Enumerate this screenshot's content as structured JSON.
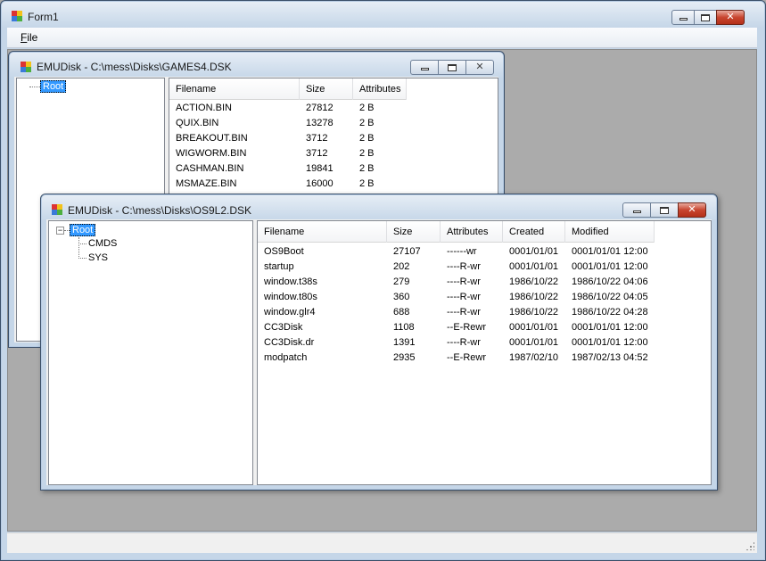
{
  "form": {
    "title": "Form1",
    "menu": [
      "File"
    ]
  },
  "window1": {
    "title": "EMUDisk - C:\\mess\\Disks\\GAMES4.DSK",
    "tree": {
      "root": "Root"
    },
    "columns": [
      "Filename",
      "Size",
      "Attributes"
    ],
    "rows": [
      [
        "ACTION.BIN",
        "27812",
        "2 B"
      ],
      [
        "QUIX.BIN",
        "13278",
        "2 B"
      ],
      [
        "BREAKOUT.BIN",
        "3712",
        "2 B"
      ],
      [
        "WIGWORM.BIN",
        "3712",
        "2 B"
      ],
      [
        "CASHMAN.BIN",
        "19841",
        "2 B"
      ],
      [
        "MSMAZE.BIN",
        "16000",
        "2 B"
      ]
    ]
  },
  "window2": {
    "title": "EMUDisk - C:\\mess\\Disks\\OS9L2.DSK",
    "tree": {
      "root": "Root",
      "expander": "−",
      "children": [
        "CMDS",
        "SYS"
      ]
    },
    "columns": [
      "Filename",
      "Size",
      "Attributes",
      "Created",
      "Modified"
    ],
    "rows": [
      [
        "OS9Boot",
        "27107",
        "------wr",
        "0001/01/01",
        "0001/01/01 12:00"
      ],
      [
        "startup",
        "202",
        "----R-wr",
        "0001/01/01",
        "0001/01/01 12:00"
      ],
      [
        "window.t38s",
        "279",
        "----R-wr",
        "1986/10/22",
        "1986/10/22 04:06"
      ],
      [
        "window.t80s",
        "360",
        "----R-wr",
        "1986/10/22",
        "1986/10/22 04:05"
      ],
      [
        "window.glr4",
        "688",
        "----R-wr",
        "1986/10/22",
        "1986/10/22 04:28"
      ],
      [
        "CC3Disk",
        "1108",
        "--E-Rewr",
        "0001/01/01",
        "0001/01/01 12:00"
      ],
      [
        "CC3Disk.dr",
        "1391",
        "----R-wr",
        "0001/01/01",
        "0001/01/01 12:00"
      ],
      [
        "modpatch",
        "2935",
        "--E-Rewr",
        "1987/02/10",
        "1987/02/13 04:52"
      ]
    ]
  },
  "colors": {
    "selection": "#3399ff",
    "mdi_background": "#ababab",
    "close_button": "#c8452f"
  },
  "icons": [
    "app-icon",
    "minimize-icon",
    "maximize-icon",
    "close-icon",
    "collapse-icon",
    "size-grip-icon"
  ]
}
